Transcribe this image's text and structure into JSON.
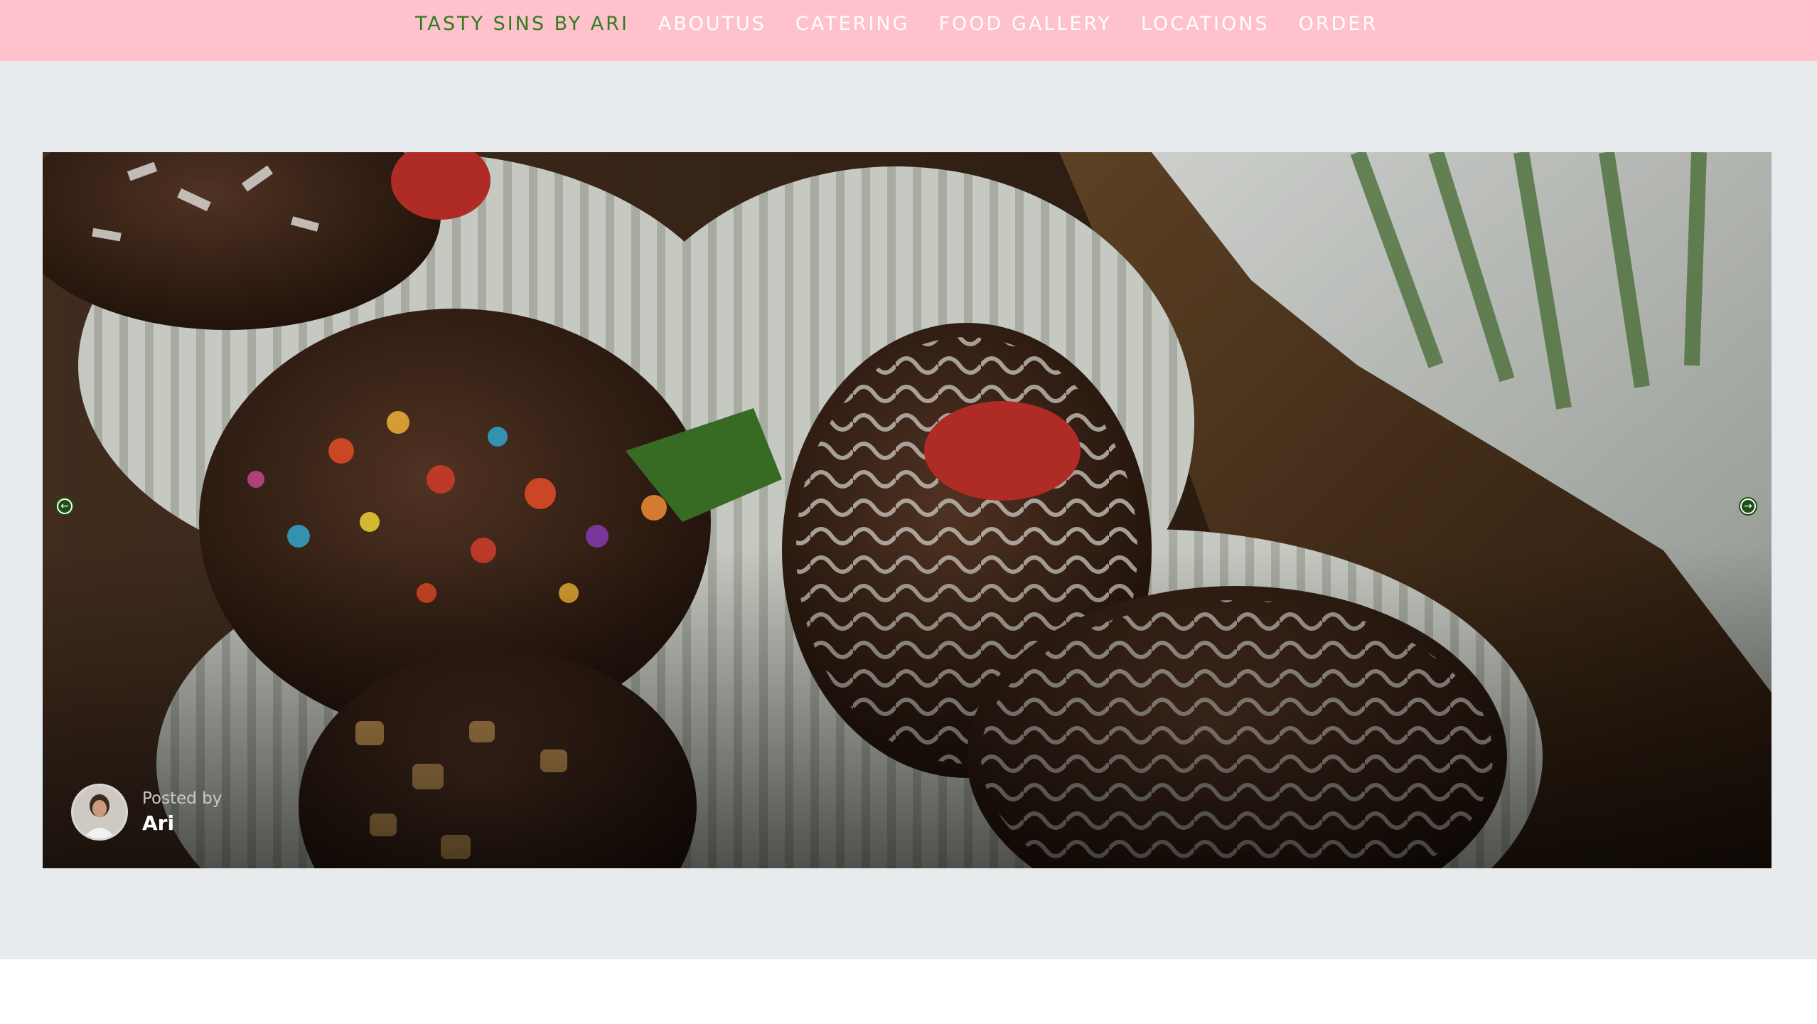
{
  "nav": {
    "brand": "TASTY SINS BY ARI",
    "links": [
      "ABOUTUS",
      "CATERING",
      "FOOD GALLERY",
      "LOCATIONS",
      "ORDER"
    ]
  },
  "slider": {
    "prev_icon": "arrow-left-circle-icon",
    "next_icon": "arrow-right-circle-icon",
    "image_subject": "chocolate-covered strawberries in paper cups",
    "author": {
      "posted_by_label": "Posted by",
      "name": "Ari"
    }
  },
  "colors": {
    "nav_background": "#ffc1cc",
    "brand_green": "#2f7d1f",
    "section_background": "#e8ebee"
  }
}
